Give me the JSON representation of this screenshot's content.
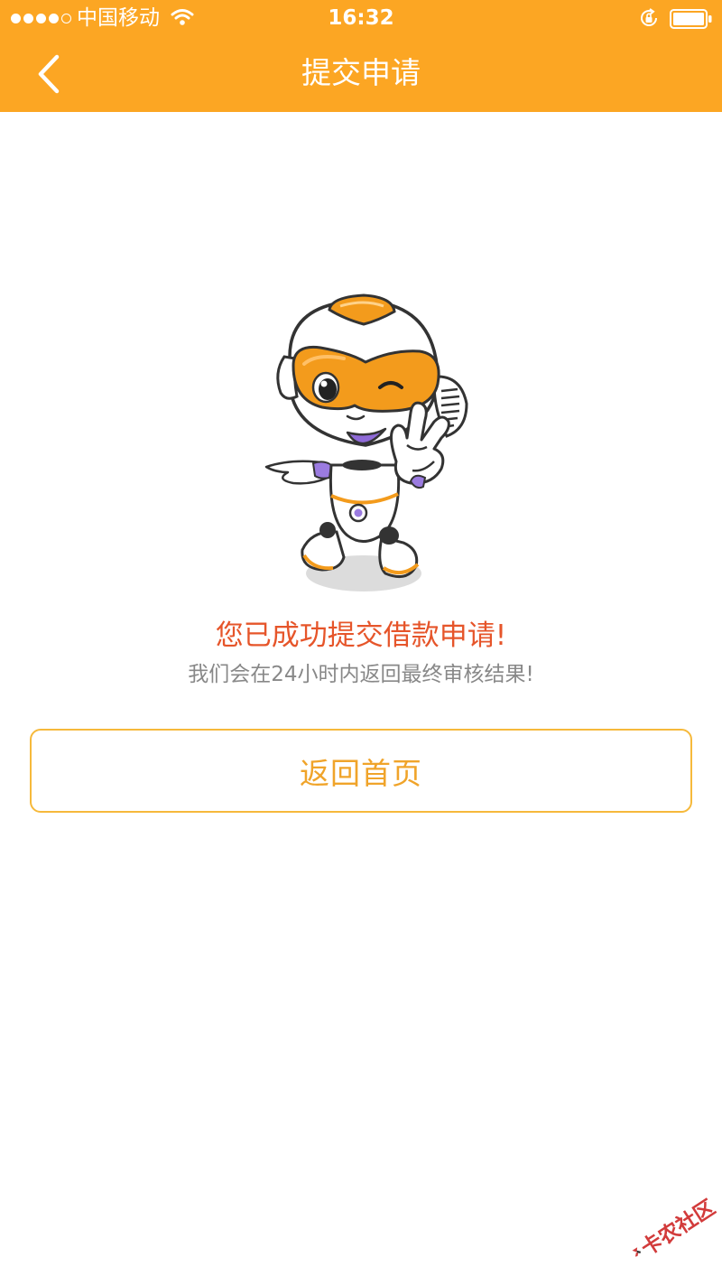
{
  "status_bar": {
    "signal_strength": 4,
    "signal_max": 5,
    "carrier": "中国移动",
    "wifi_icon": "wifi-icon",
    "time": "16:32",
    "rotation_lock_icon": "rotation-lock-icon",
    "battery_icon": "battery-icon"
  },
  "nav": {
    "back_icon": "chevron-left-icon",
    "title": "提交申请"
  },
  "illustration": {
    "name": "robot-mascot-v-sign"
  },
  "message": {
    "title": "您已成功提交借款申请!",
    "subtitle": "我们会在24小时内返回最终审核结果!"
  },
  "actions": {
    "home_label": "返回首页"
  },
  "watermark": {
    "text": "卡农社区"
  },
  "colors": {
    "header": "#fca623",
    "success_title": "#e6552a",
    "subtitle": "#888888",
    "button_border": "#f6b93b",
    "button_text": "#f0a42a"
  }
}
